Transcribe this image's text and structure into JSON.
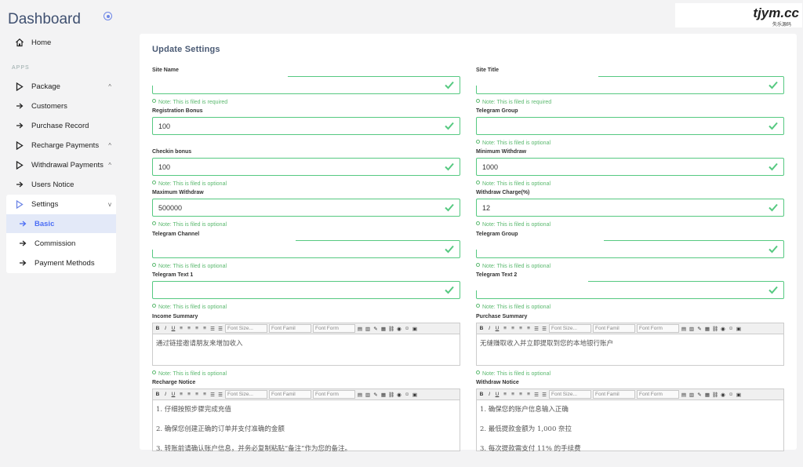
{
  "sidebar": {
    "title": "Dashboard",
    "section": "APPS",
    "items": [
      {
        "label": "Home",
        "icon": "home-icon"
      },
      {
        "label": "Package",
        "icon": "play-icon",
        "chevron": "^"
      },
      {
        "label": "Customers",
        "icon": "arrow-right-icon"
      },
      {
        "label": "Purchase Record",
        "icon": "arrow-right-icon"
      },
      {
        "label": "Recharge Payments",
        "icon": "play-icon",
        "chevron": "^"
      },
      {
        "label": "Withdrawal Payments",
        "icon": "play-icon",
        "chevron": "^"
      },
      {
        "label": "Users Notice",
        "icon": "arrow-right-icon"
      },
      {
        "label": "Settings",
        "icon": "play-icon",
        "chevron": "v"
      }
    ],
    "submenu": [
      {
        "label": "Basic",
        "selected": true
      },
      {
        "label": "Commission"
      },
      {
        "label": "Payment Methods"
      }
    ]
  },
  "logo": {
    "text": "tjym.cc",
    "sub": "失乐源码"
  },
  "main": {
    "title": "Update Settings",
    "fields": [
      {
        "label": "Site Name",
        "value": "",
        "note": "Note: This is filed is required"
      },
      {
        "label": "Site Title",
        "value": "",
        "note": "Note: This is filed is required"
      },
      {
        "label": "Registration Bonus",
        "value": "100",
        "note": ""
      },
      {
        "label": "Telegram Group",
        "value": "",
        "note": "Note: This is filed is optional"
      },
      {
        "label": "Checkin bonus",
        "value": "100",
        "note": "Note: This is filed is optional"
      },
      {
        "label": "Minimum Withdraw",
        "value": "1000",
        "note": "Note: This is filed is optional"
      },
      {
        "label": "Maximum Withdraw",
        "value": "500000",
        "note": "Note: This is filed is optional"
      },
      {
        "label": "Withdraw Charge(%)",
        "value": "12",
        "note": "Note: This is filed is optional"
      },
      {
        "label": "Telegram Channel",
        "value": "",
        "note": "Note: This is filed is optional"
      },
      {
        "label": "Telegram Group",
        "value": "",
        "note": "Note: This is filed is optional"
      },
      {
        "label": "Telegram Text 1",
        "value": "",
        "note": "Note: This is filed is optional"
      },
      {
        "label": "Telegram Text 2",
        "value": "",
        "note": "Note: This is filed is optional"
      }
    ],
    "editors": [
      {
        "label": "Income Summary",
        "lines": [
          "通过链接邀请朋友来增加收入"
        ],
        "note": "Note: This is filed is optional"
      },
      {
        "label": "Purchase Summary",
        "lines": [
          "无缝赚取收入并立即提取到您的本地银行账户"
        ],
        "note": "Note: This is filed is optional"
      },
      {
        "label": "Recharge Notice",
        "lines": [
          "1. 仔细按照步骤完成充值",
          "2. 确保您创建正确的订单并支付准确的金额",
          "3. 转账前请确认账户信息，并务必复制粘贴“备注”作为您的备注。"
        ]
      },
      {
        "label": "Withdraw Notice",
        "lines": [
          "1. 确保您的账户信息输入正确",
          "2. 最低提款金额为 1,000 奈拉",
          "3. 每次提款需支付 11% 的手续费"
        ]
      }
    ],
    "toolbar": {
      "font_size": "Font Size...",
      "font_family": "Font Famil",
      "font_format": "Font Form"
    }
  },
  "colors": {
    "accent": "#4c6ef5",
    "valid": "#56c981",
    "note": "#5bb96f"
  }
}
